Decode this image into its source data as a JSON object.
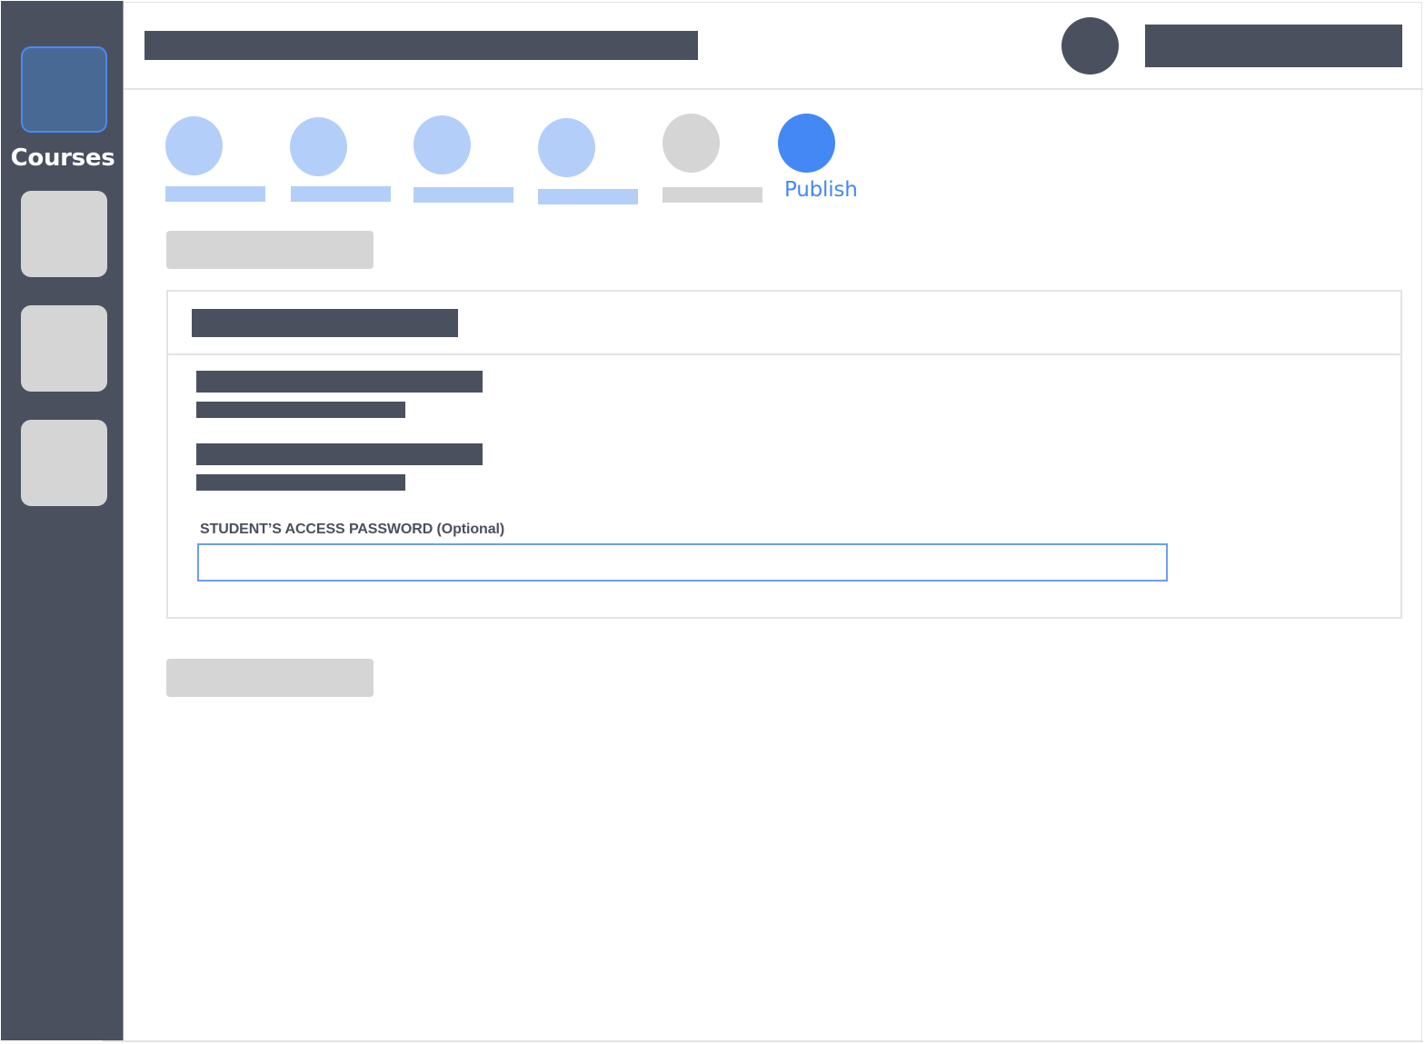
{
  "sidebar": {
    "items": [
      {
        "label": "Courses",
        "state": "active",
        "icon": "courses-icon"
      },
      {
        "label": "",
        "state": "inactive",
        "icon": "nav-placeholder-icon"
      },
      {
        "label": "",
        "state": "inactive",
        "icon": "nav-placeholder-icon"
      },
      {
        "label": "",
        "state": "inactive",
        "icon": "nav-placeholder-icon"
      }
    ]
  },
  "header": {
    "title_placeholder": "",
    "user_name_placeholder": ""
  },
  "stepper": {
    "steps": [
      {
        "label": "",
        "state": "completed"
      },
      {
        "label": "",
        "state": "completed"
      },
      {
        "label": "",
        "state": "completed"
      },
      {
        "label": "",
        "state": "completed"
      },
      {
        "label": "",
        "state": "pending"
      },
      {
        "label": "Publish",
        "state": "current"
      }
    ]
  },
  "form": {
    "password_label": "STUDENT’S ACCESS PASSWORD (Optional)",
    "password_value": "",
    "password_placeholder": ""
  },
  "colors": {
    "sidebar_bg": "#4b505f",
    "active_tile": "#486994",
    "accent": "#4488f6",
    "step_completed": "#b4cefa",
    "placeholder_gray": "#d5d5d5",
    "border": "#e3e3e3"
  }
}
